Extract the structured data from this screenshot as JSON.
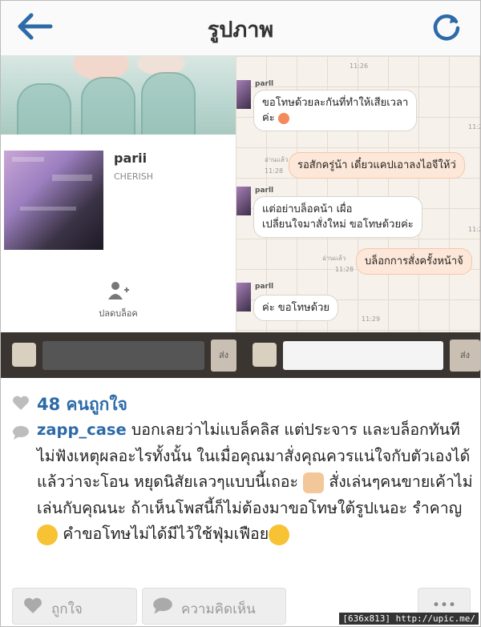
{
  "header": {
    "title": "รูปภาพ",
    "back_icon": "back-arrow-icon",
    "refresh_icon": "refresh-icon"
  },
  "embedded": {
    "profile": {
      "name": "parii",
      "subtitle": "CHERISH",
      "unblock_label": "ปลดบล็อค"
    },
    "chat": {
      "sender": "parll",
      "messages": [
        {
          "dir": "in",
          "line1": "ขอโทษด้วยละกันที่ทำให้เสียเวลา",
          "line2": "ค่ะ",
          "time": "11:28"
        },
        {
          "dir": "out",
          "text": "รอสักครู่น้า เดี๋ยวแคปเอาลงไอจีให้ว่",
          "read": "อ่านแล้ว",
          "time": "11:28"
        },
        {
          "dir": "in",
          "line1": "แต่อย่าบล็อคน้า เผื่อ",
          "line2": "เปลี่ยนใจมาสั่งใหม่ ขอโทษด้วยค่ะ",
          "time": "11:28"
        },
        {
          "dir": "out",
          "text": "บล็อกการสั่งครั้งหน้าจ้",
          "read": "อ่านแล้ว",
          "time": "11:28"
        },
        {
          "dir": "in",
          "text": "ค่ะ ขอโทษด้วย",
          "time": "11:29"
        }
      ],
      "top_time": "11:26",
      "send_label_left": "ส่ง",
      "send_label_right": "ส่ง"
    }
  },
  "likes": {
    "text": "48 คนถูกใจ"
  },
  "caption": {
    "username": "zapp_case",
    "part1": " บอกเลยว่าไม่แบล็คลิส แต่ประจาร และบล็อกทันที ไม่ฟังเหตุผลอะไรทั้งนั้น ในเมื่อคุณมาสั่งคุณควรแน่ใจกับตัวเองได้แล้วว่าจะโอน หยุดนิสัยเลวๆแบบนี้เถอะ ",
    "part2": " สั่งเล่นๆคนขายเค้าไม่เล่นกับคุณนะ ถ้าเห็นโพสนี้ก็ไม่ต้องมาขอโทษใต้รูปเนอะ รำคาญ",
    "part3": " คำขอโทษไม่ได้มีไว้ใช้ฟุ่มเฟือย",
    "emoji_names": [
      "thumbs-down-icon",
      "kiss-face-icon",
      "grimace-face-icon"
    ]
  },
  "actions": {
    "like_label": "ถูกใจ",
    "comment_label": "ความคิดเห็น",
    "more_label": "•••"
  },
  "watermark": "[636x813] http://upic.me/",
  "colors": {
    "accent": "#2d6aa8",
    "chat_out": "#fde7d8"
  }
}
